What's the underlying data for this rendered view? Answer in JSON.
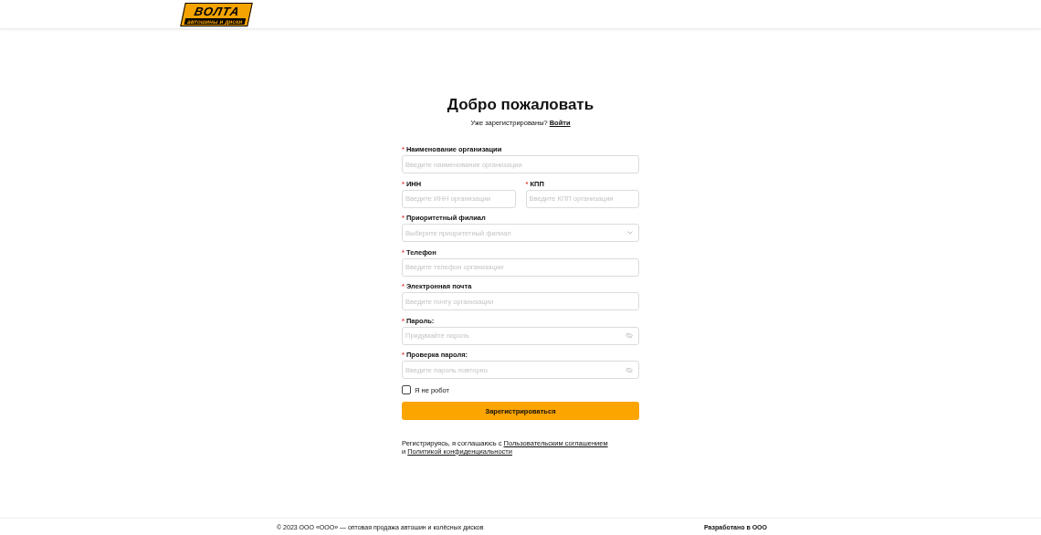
{
  "header": {
    "logo": {
      "name": "ВОЛТА",
      "tagline": "автошины и диски"
    }
  },
  "title": "Добро пожаловать",
  "required_mark": "*",
  "login_prompt": {
    "text": "Уже зарегистрированы?",
    "link": "Войти"
  },
  "rows": [
    {
      "fields": [
        {
          "label": "Наименование организации",
          "required": true,
          "kind": "text",
          "placeholder": "Введите наименование организации"
        }
      ]
    },
    {
      "fields": [
        {
          "label": "ИНН",
          "required": true,
          "kind": "text",
          "placeholder": "Введите ИНН организации"
        },
        {
          "label": "КПП",
          "required": true,
          "kind": "text",
          "placeholder": "Введите КПП организации"
        }
      ]
    },
    {
      "fields": [
        {
          "label": "Приоритетный филиал",
          "required": true,
          "kind": "select",
          "placeholder": "Выберите приоритетный филиал"
        }
      ]
    },
    {
      "fields": [
        {
          "label": "Телефон",
          "required": true,
          "kind": "text",
          "placeholder": "Введите телефон организации"
        }
      ]
    },
    {
      "fields": [
        {
          "label": "Электронная почта",
          "required": true,
          "kind": "text",
          "placeholder": "Введите почту организации"
        }
      ]
    },
    {
      "fields": [
        {
          "label": "Пароль:",
          "required": true,
          "kind": "password",
          "placeholder": "Придумайте пароль"
        }
      ]
    },
    {
      "fields": [
        {
          "label": "Проверка пароля:",
          "required": true,
          "kind": "password",
          "placeholder": "Введите пароль повторно"
        }
      ]
    }
  ],
  "captcha": {
    "label": "Я не робот",
    "checked": false
  },
  "submit": "Зарегистрироваться",
  "agreement": {
    "text1": "Регистрируясь, я соглашаюсь с",
    "link1": "Пользовательским соглашением",
    "text2": "и",
    "link2": "Политикой конфиденциальности"
  },
  "footer": {
    "copyright": "© 2023 ООО «ООО» — оптовая продажа автошин и колёсных дисков",
    "credit": "Разработано в ООО"
  }
}
